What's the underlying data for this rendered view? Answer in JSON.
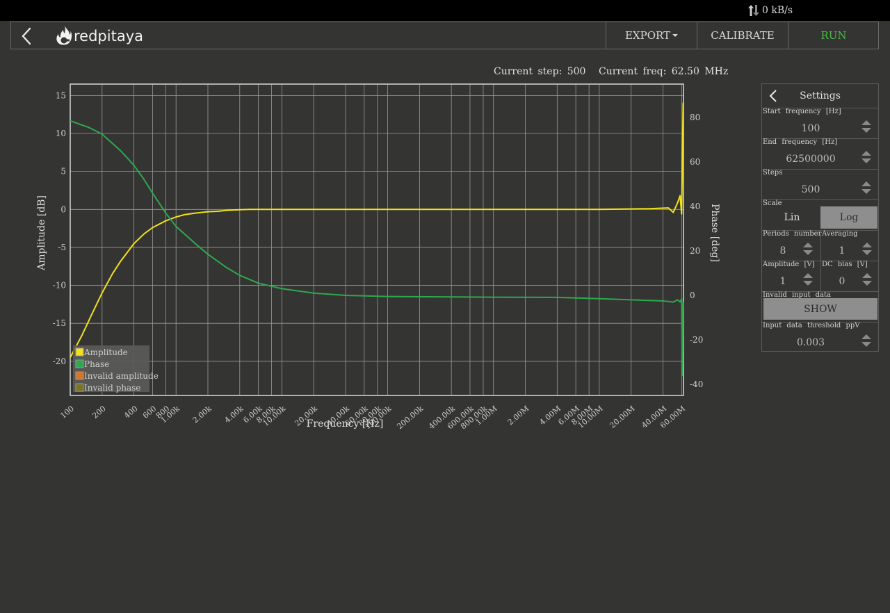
{
  "network": {
    "rate": "0 kB/s"
  },
  "navbar": {
    "logo_text": "redpitaya",
    "export_label": "EXPORT",
    "calibrate_label": "CALIBRATE",
    "run_label": "RUN",
    "run_color": "#4cb94a"
  },
  "status": {
    "step_text": "Current  step:  500",
    "freq_text": "Current  freq:  62.50  MHz"
  },
  "chart_data": {
    "type": "line",
    "xlabel": "Frequency   [Hz]",
    "ylabel": "Amplitude  [dB]",
    "y2label": "Phase  [deg]",
    "x_scale": "log",
    "xlim": [
      100,
      62500000
    ],
    "ylim": [
      -24.5,
      16.5
    ],
    "y2lim": [
      -45,
      95
    ],
    "grid": true,
    "x_ticks": [
      100,
      200,
      400,
      600,
      800,
      1000,
      2000,
      4000,
      6000,
      8000,
      10000,
      20000,
      40000,
      60000,
      80000,
      100000,
      200000,
      400000,
      600000,
      800000,
      1000000,
      2000000,
      4000000,
      6000000,
      8000000,
      10000000,
      20000000,
      40000000,
      60000000
    ],
    "x_tick_labels": [
      "100",
      "200",
      "400",
      "600",
      "800",
      "1.00k",
      "2.00k",
      "4.00k",
      "6.00k",
      "8.00k",
      "10.00k",
      "20.00k",
      "40.00k",
      "60.00k",
      "80.00k",
      "100.00k",
      "200.00k",
      "400.00k",
      "600.00k",
      "800.00k",
      "1.00M",
      "2.00M",
      "4.00M",
      "6.00M",
      "8.00M",
      "10.00M",
      "20.00M",
      "40.00M",
      "60.00M"
    ],
    "y_ticks": [
      15,
      10,
      5,
      0,
      -5,
      -10,
      -15,
      -20
    ],
    "y2_ticks": [
      80,
      60,
      40,
      20,
      0,
      -20,
      -40
    ],
    "legend": {
      "placement": "bottom-left"
    },
    "series": [
      {
        "name": "Amplitude",
        "axis": "left",
        "color": "#f2e21b",
        "x": [
          100,
          130,
          160,
          200,
          250,
          300,
          400,
          500,
          600,
          800,
          1000,
          1200,
          1500,
          2000,
          2500,
          3000,
          4000,
          5000,
          6000,
          8000,
          10000,
          20000,
          100000,
          1000000,
          10000000,
          30000000,
          45000000,
          50000000,
          55000000,
          58000000,
          60000000,
          62000000,
          62500000
        ],
        "y": [
          -19.5,
          -16.5,
          -13.8,
          -11,
          -8.5,
          -6.8,
          -4.5,
          -3.2,
          -2.4,
          -1.5,
          -1.0,
          -0.7,
          -0.5,
          -0.3,
          -0.25,
          -0.12,
          -0.05,
          0,
          0,
          0,
          0,
          0,
          0,
          0,
          0,
          0.1,
          0.2,
          -0.4,
          0.9,
          1.8,
          -0.6,
          14,
          14
        ]
      },
      {
        "name": "Phase",
        "axis": "right",
        "color": "#2fa84f",
        "x": [
          100,
          150,
          200,
          300,
          400,
          500,
          600,
          800,
          1000,
          1500,
          2000,
          3000,
          4000,
          6000,
          10000,
          20000,
          40000,
          100000,
          1000000,
          4000000,
          10000000,
          20000000,
          40000000,
          50000000,
          55000000,
          58000000,
          60000000,
          61000000,
          62000000,
          62500000
        ],
        "y": [
          78.5,
          75.5,
          72.5,
          65,
          58.5,
          52,
          46,
          37,
          31,
          23.5,
          18.5,
          12.5,
          9,
          5.5,
          3,
          1,
          0,
          -0.5,
          -0.8,
          -0.9,
          -1.5,
          -2,
          -2.5,
          -3,
          -2,
          -3,
          -1.5,
          -36,
          -3,
          -3
        ]
      }
    ],
    "legend_entries": [
      {
        "label": "Amplitude",
        "color": "#f2e21b"
      },
      {
        "label": "Phase",
        "color": "#2fa84f"
      },
      {
        "label": "Invalid  amplitude",
        "color": "#d4762a"
      },
      {
        "label": "Invalid  phase",
        "color": "#7a7228"
      }
    ]
  },
  "settings": {
    "title": "Settings",
    "start_freq": {
      "label": "Start  frequency  [Hz]",
      "value": "100"
    },
    "end_freq": {
      "label": "End  frequency  [Hz]",
      "value": "62500000"
    },
    "steps": {
      "label": "Steps",
      "value": "500"
    },
    "scale": {
      "label": "Scale",
      "options": [
        "Lin",
        "Log"
      ],
      "selected": "Log"
    },
    "periods": {
      "label": "Periods  number",
      "value": "8"
    },
    "averaging": {
      "label": "Averaging",
      "value": "1"
    },
    "amplitude": {
      "label": "Amplitude  [V]",
      "value": "1"
    },
    "dc_bias": {
      "label": "DC bias  [V]",
      "value": "0"
    },
    "invalid": {
      "label": "Invalid  input  data",
      "button": "SHOW"
    },
    "threshold": {
      "label": "Input  data  threshold  ppV",
      "value": "0.003"
    }
  }
}
